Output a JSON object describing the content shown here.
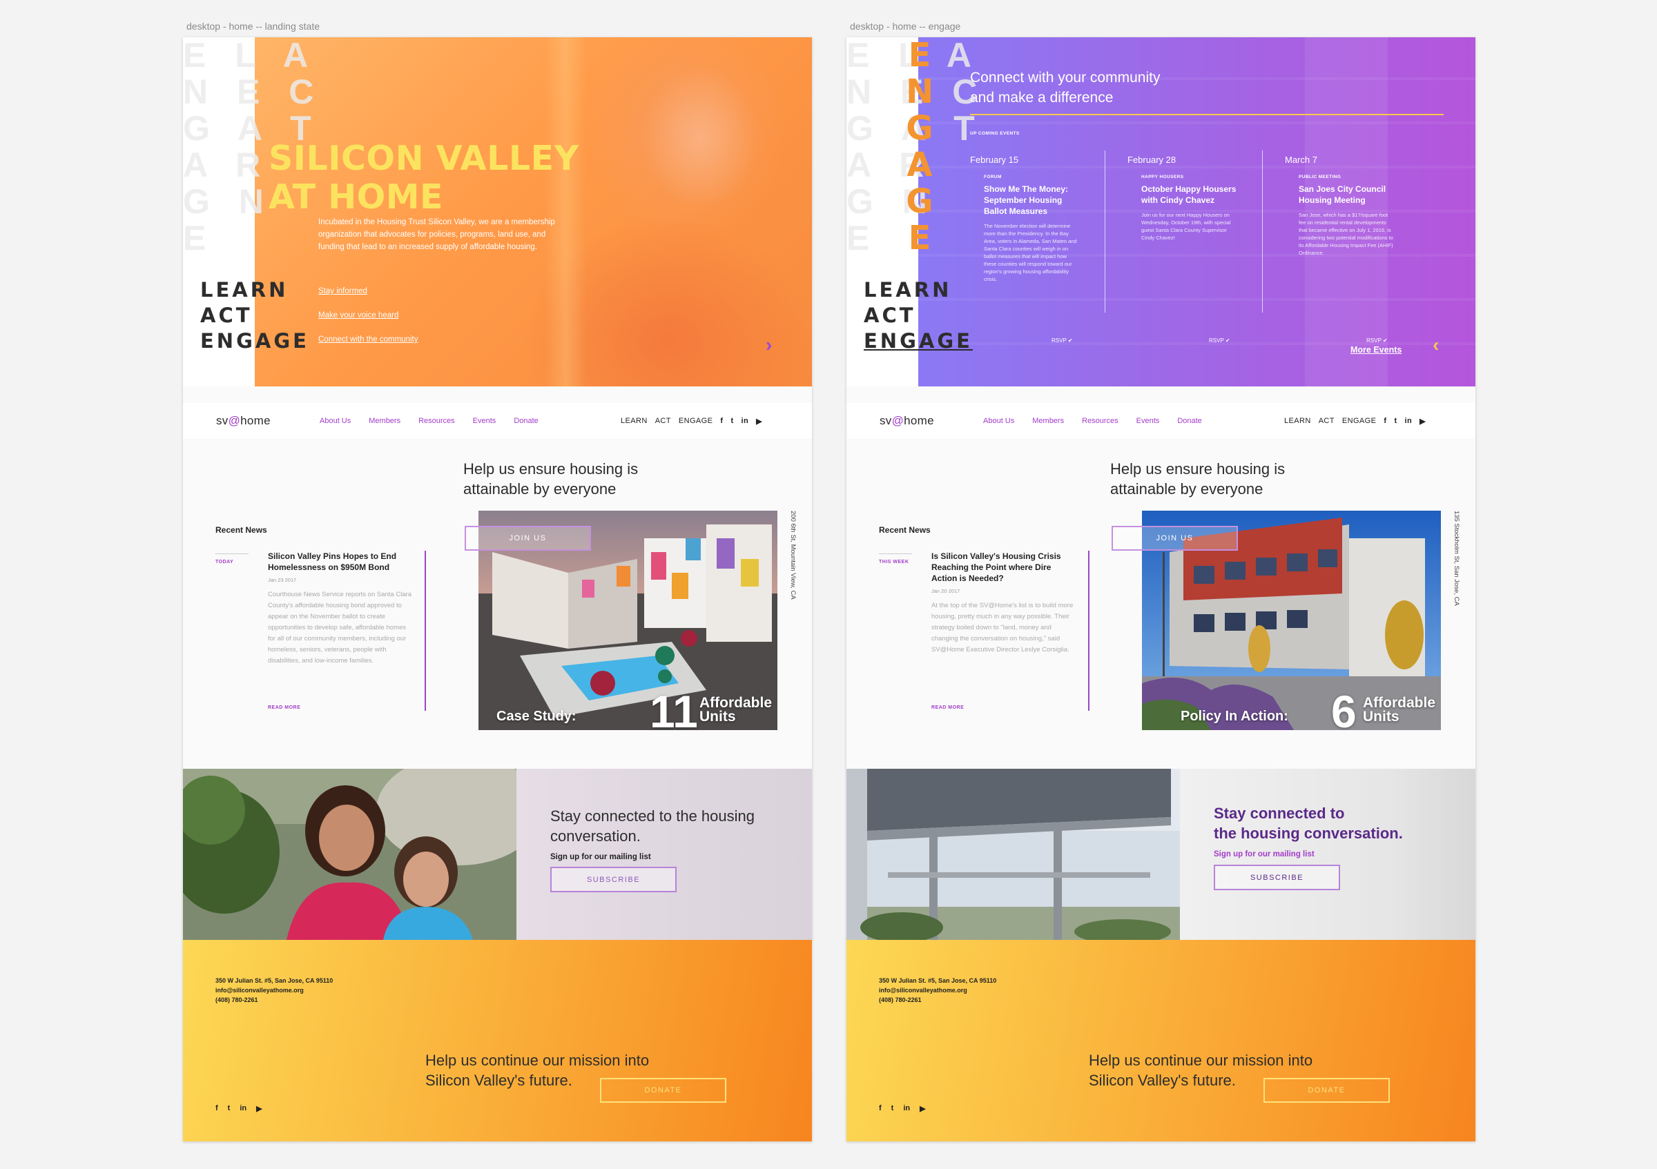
{
  "labels": {
    "left": "desktop - home -- landing state",
    "right": "desktop - home -- engage"
  },
  "ghost_letters": "E L A\nN E C\nG A T\nA R\nG N\nE",
  "lae": {
    "learn": "LEARN",
    "act": "ACT",
    "engage": "ENGAGE"
  },
  "hero1": {
    "title_line1": "SILICON VALLEY",
    "title_line2": "AT HOME",
    "intro": "Incubated in the Housing Trust Silicon Valley, we are a membership organization that advocates for policies, programs, land use, and funding that lead to an increased supply of affordable housing.",
    "links": [
      "Stay informed",
      "Make your voice heard",
      "Connect with the community"
    ],
    "chevron": "›"
  },
  "hero2": {
    "engage_letters": [
      "E",
      "N",
      "G",
      "A",
      "G",
      "E"
    ],
    "connect_line1": "Connect with your community",
    "connect_line2": "and make a difference",
    "upcoming": "UP COMING EVENTS",
    "events": [
      {
        "date": "February 15",
        "category": "FORUM",
        "title": "Show Me The Money: September Housing Ballot Measures",
        "desc": "The November election will determine more than the Presidency. In the Bay Area, voters in Alameda, San Mateo and Santa Clara counties will weigh in on ballot measures that will impact how these counties will respond toward our region's growing housing affordability crisis.",
        "rsvp": "RSVP ✔"
      },
      {
        "date": "February 28",
        "category": "HAPPY HOUSERS",
        "title": "October Happy Housers with Cindy Chavez",
        "desc": "Join us for our next Happy Housers on Wednesday, October 19th, with special guest Santa Clara County Supervisor Cindy Chavez!",
        "rsvp": "RSVP ✔"
      },
      {
        "date": "March 7",
        "category": "PUBLIC MEETING",
        "title": "San Joes City Council Housing Meeting",
        "desc": "San Jose, which has a $17/square foot fee on residential rental developments that became effective on July 1, 2016, is considering two potential modifications to its Affordable Housing Impact Fee (AHIF) Ordinance.",
        "rsvp": "RSVP ✔"
      }
    ],
    "more_events": "More Events",
    "chevron": "‹"
  },
  "nav": {
    "logo_a": "sv",
    "logo_b": "@",
    "logo_c": "home",
    "links": [
      "About Us",
      "Members",
      "Resources",
      "Events",
      "Donate"
    ],
    "right": [
      "LEARN",
      "ACT",
      "ENGAGE"
    ],
    "social": [
      "f",
      "t",
      "in",
      "▶"
    ]
  },
  "help": {
    "line1": "Help us ensure housing is",
    "line2": "attainable by everyone"
  },
  "join": "JOIN US",
  "news1": {
    "heading": "Recent News",
    "tag": "TODAY",
    "title": "Silicon Valley Pins Hopes to End Homelessness on $950M Bond",
    "date": "Jan 23 2017",
    "body": "Courthouse News Service reports on Santa Clara County's affordable housing bond approved to appear on the November ballot to create opportunities to develop safe, affordable homes for all of our community members, including our homeless, seniors, veterans, people with disabilities, and low-income families.",
    "read_more": "READ MORE"
  },
  "news2": {
    "heading": "Recent News",
    "tag": "THIS WEEK",
    "title": "Is Silicon Valley's Housing Crisis Reaching the Point where Dire Action is Needed?",
    "date": "Jan 20 2017",
    "body": "At the top of the SV@Home's list is to build more housing, pretty much in any way possible. Their strategy boiled down to \"land, money and changing the conversation on housing,\" said SV@Home Executive Director Leslye Corsiglia.",
    "read_more": "READ MORE"
  },
  "feature1": {
    "caption": "Case Study:",
    "number": "11",
    "unit1": "Affordable",
    "unit2": "Units",
    "address": "200 6th St, Mountain View, CA"
  },
  "feature2": {
    "caption": "Policy In Action:",
    "number": "6",
    "unit1": "Affordable",
    "unit2": "Units",
    "address": "135 Stockholm St, San Jose, CA"
  },
  "stay": {
    "line1": "Stay connected to the housing",
    "line2": "conversation.",
    "line1b": "Stay connected to",
    "line2b": "the housing conversation.",
    "sub": "Sign up for our mailing list",
    "button": "SUBSCRIBE"
  },
  "footer": {
    "address": "350 W Julian St. #5, San Jose, CA 95110",
    "email": "info@siliconvalleyathome.org",
    "phone": "(408) 780-2261",
    "line1": "Help us continue our mission into",
    "line2": "Silicon Valley's future.",
    "donate": "DONATE",
    "social": [
      "f",
      "t",
      "in",
      "▶"
    ]
  }
}
